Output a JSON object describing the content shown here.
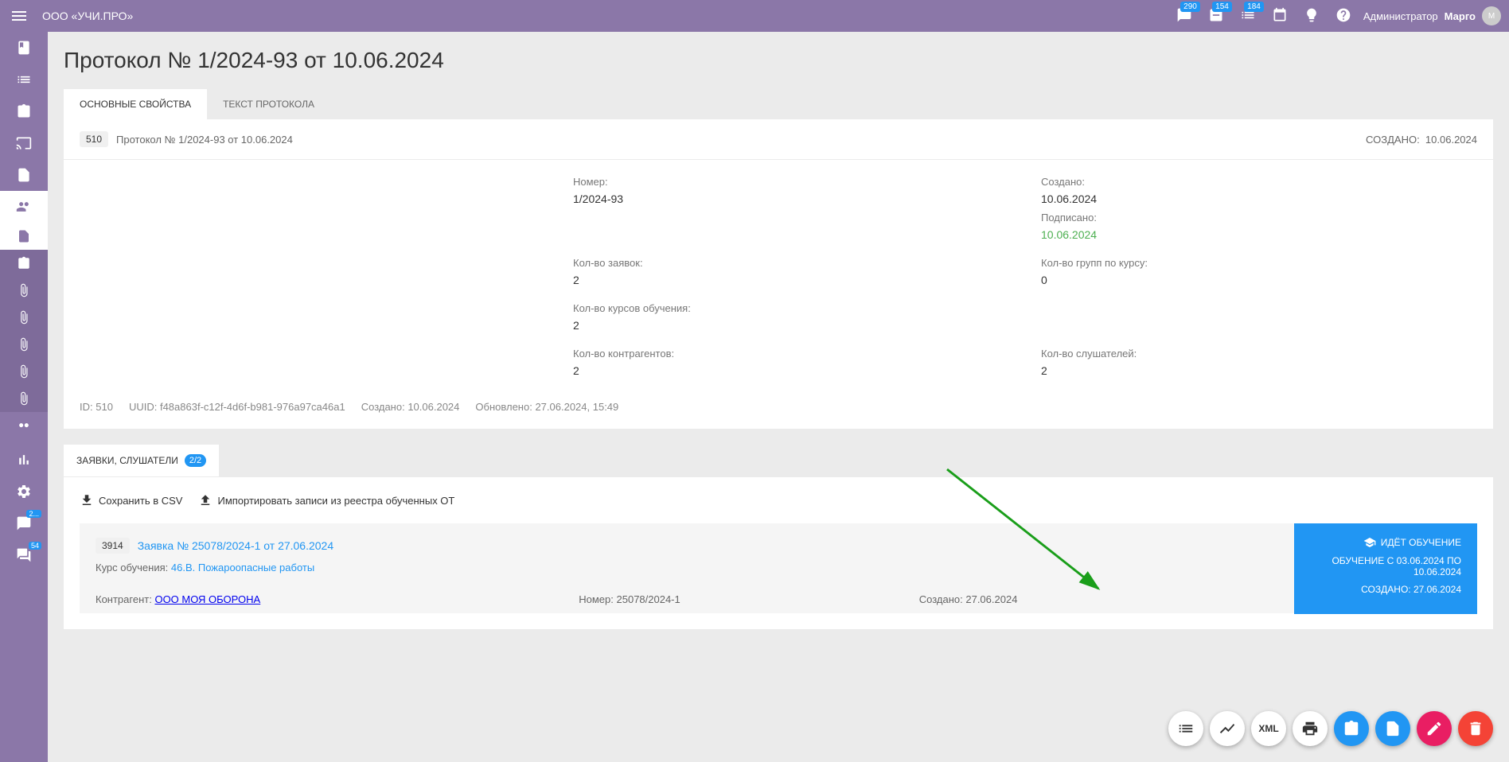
{
  "header": {
    "org_name": "ООО «УЧИ.ПРО»",
    "badge1": "290",
    "badge2": "154",
    "badge3": "184",
    "user_role": "Администратор",
    "user_name": "Марго"
  },
  "sidebar": {
    "badge_chat": "2...",
    "badge_comment": "54"
  },
  "page_title": "Протокол № 1/2024-93 от 10.06.2024",
  "tabs": {
    "main_props": "ОСНОВНЫЕ СВОЙСТВА",
    "protocol_text": "ТЕКСТ ПРОТОКОЛА"
  },
  "info_bar": {
    "id": "510",
    "title": "Протокол № 1/2024-93 от 10.06.2024",
    "created_label": "СОЗДАНО:",
    "created_date": "10.06.2024"
  },
  "props": {
    "number_label": "Номер:",
    "number_value": "1/2024-93",
    "created_label": "Создано:",
    "created_value": "10.06.2024",
    "signed_label": "Подписано:",
    "signed_value": "10.06.2024",
    "requests_label": "Кол-во заявок:",
    "requests_value": "2",
    "course_groups_label": "Кол-во групп по курсу:",
    "course_groups_value": "0",
    "courses_label": "Кол-во курсов обучения:",
    "courses_value": "2",
    "contractors_label": "Кол-во контрагентов:",
    "contractors_value": "2",
    "listeners_label": "Кол-во слушателей:",
    "listeners_value": "2"
  },
  "meta": {
    "id_label": "ID:",
    "id_value": "510",
    "uuid_label": "UUID:",
    "uuid_value": "f48a863f-c12f-4d6f-b981-976a97ca46a1",
    "created_label": "Создано:",
    "created_value": "10.06.2024",
    "updated_label": "Обновлено:",
    "updated_value": "27.06.2024, 15:49"
  },
  "sub_tab": {
    "label": "ЗАЯВКИ, СЛУШАТЕЛИ",
    "badge": "2/2"
  },
  "actions": {
    "csv": "Сохранить в CSV",
    "import": "Импортировать записи из реестра обученных ОТ"
  },
  "request": {
    "id": "3914",
    "link": "Заявка № 25078/2024-1 от 27.06.2024",
    "course_label": "Курс обучения:",
    "course_link": "46.В. Пожароопасные работы",
    "contractor_label": "Контрагент:",
    "contractor_link": "ООО МОЯ ОБОРОНА",
    "number_label": "Номер:",
    "number_value": "25078/2024-1",
    "created_label": "Создано:",
    "created_value": "27.06.2024"
  },
  "status": {
    "training": "ИДЁТ ОБУЧЕНИЕ",
    "period": "ОБУЧЕНИЕ С 03.06.2024 ПО 10.06.2024",
    "created": "СОЗДАНО: 27.06.2024"
  },
  "fab": {
    "xml": "XML"
  }
}
